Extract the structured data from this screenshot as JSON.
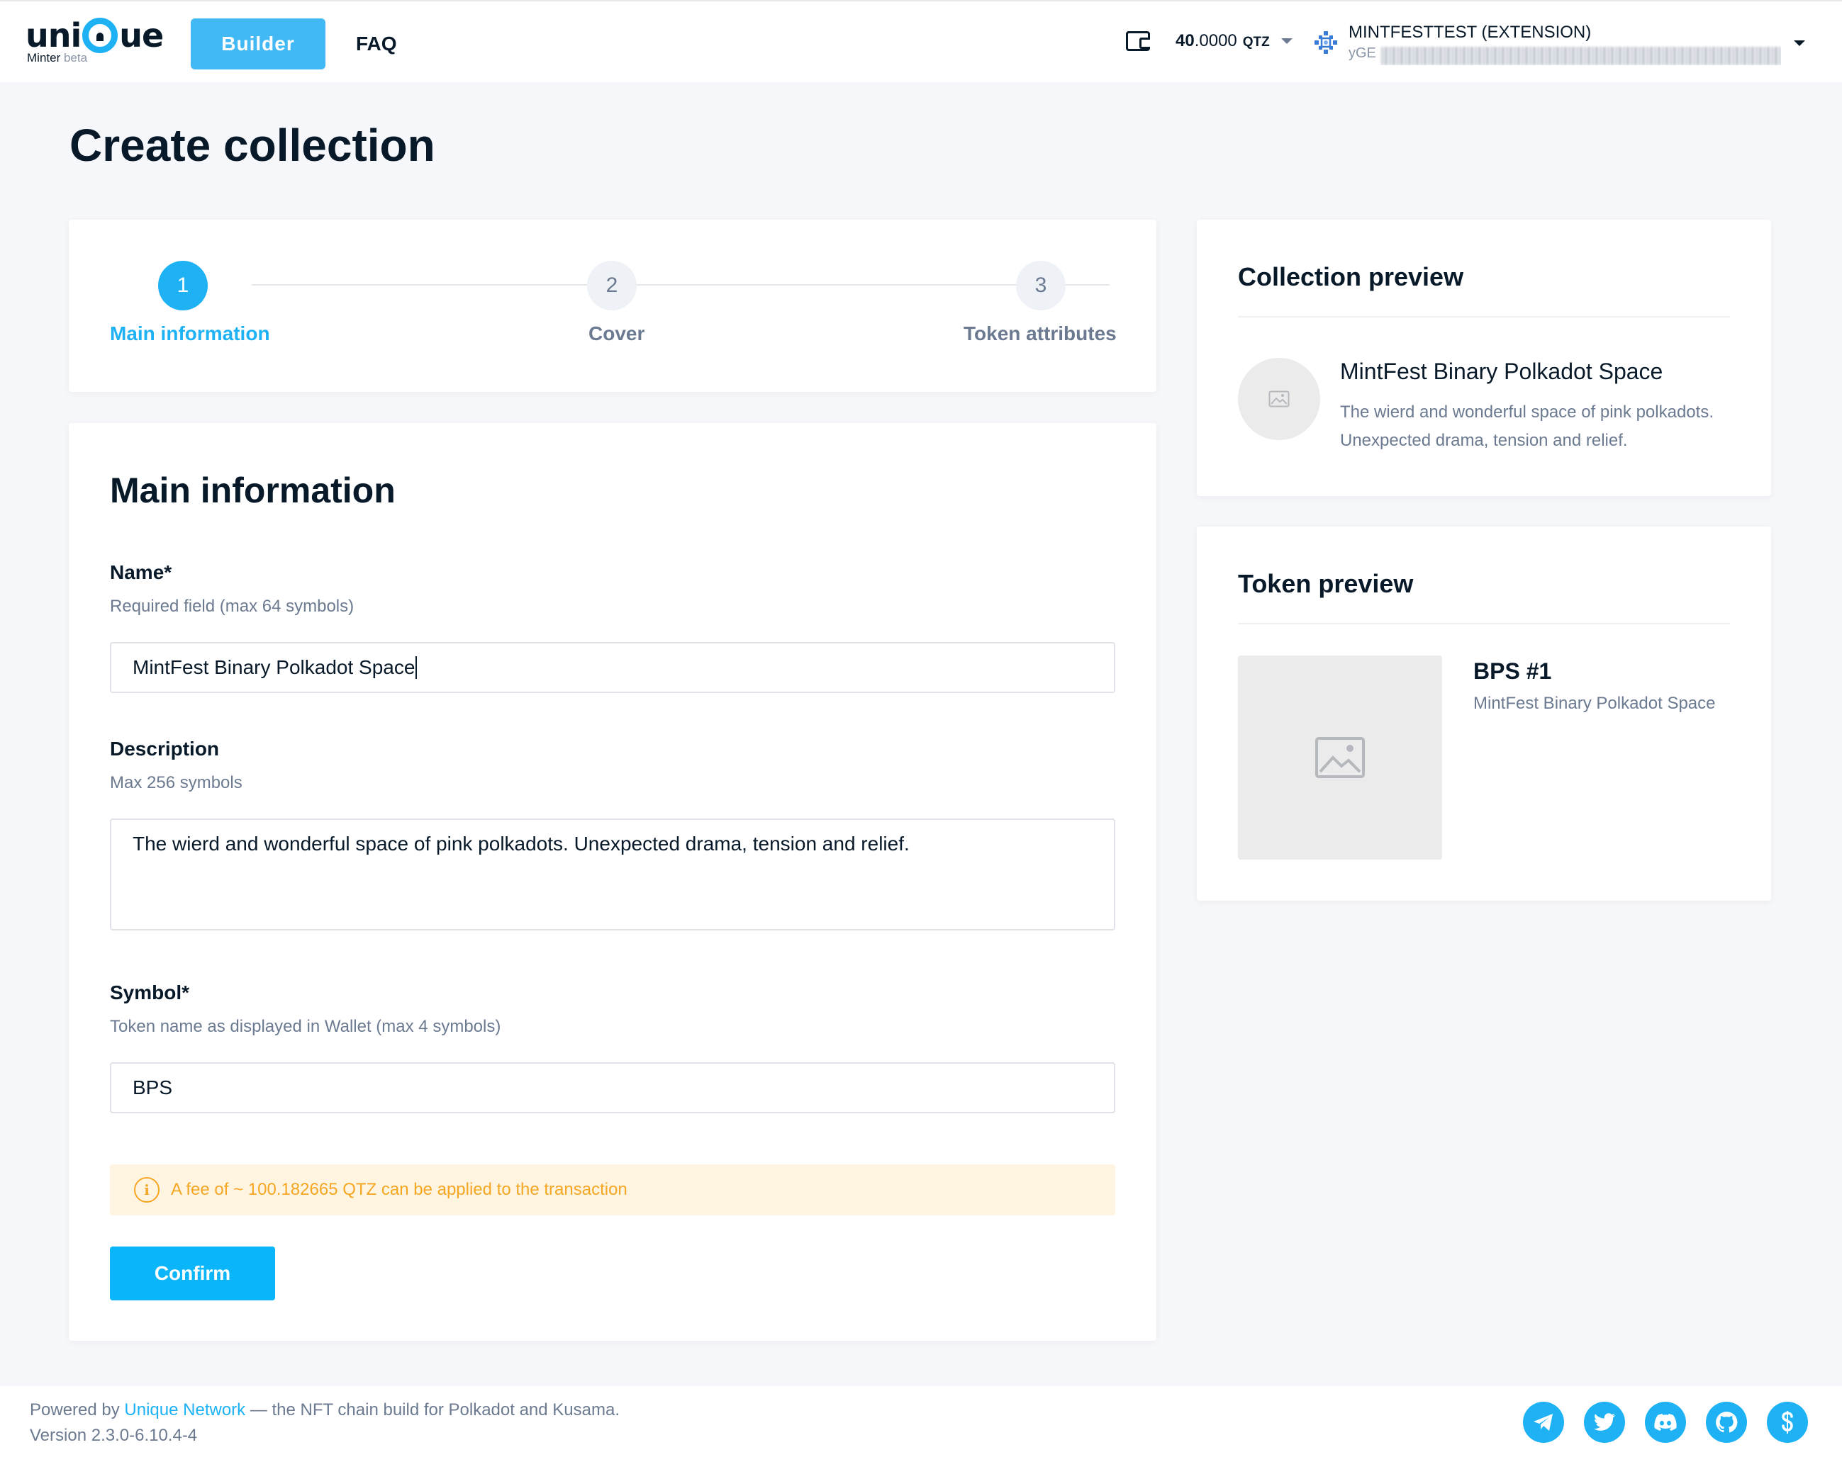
{
  "header": {
    "logo_text_left": "uni",
    "logo_text_right": "ue",
    "logo_sub": "Minter",
    "logo_beta": "beta",
    "nav": {
      "builder": "Builder",
      "faq": "FAQ"
    },
    "balance": {
      "amount_int": "40",
      "amount_dec": ".0000",
      "currency": "QTZ"
    },
    "account": {
      "name": "MINTFESTTEST (EXTENSION)",
      "address_prefix": "yGE"
    }
  },
  "page_title": "Create collection",
  "stepper": {
    "steps": [
      {
        "num": "1",
        "label": "Main information",
        "active": true
      },
      {
        "num": "2",
        "label": "Cover",
        "active": false
      },
      {
        "num": "3",
        "label": "Token attributes",
        "active": false
      }
    ]
  },
  "form": {
    "title": "Main information",
    "name": {
      "label": "Name*",
      "hint": "Required field (max 64 symbols)",
      "value": "MintFest Binary Polkadot Space"
    },
    "description": {
      "label": "Description",
      "hint": "Max 256 symbols",
      "value": "The wierd and wonderful space of pink polkadots. Unexpected drama, tension and relief."
    },
    "symbol": {
      "label": "Symbol*",
      "hint": "Token name as displayed in Wallet (max 4 symbols)",
      "value": "BPS"
    },
    "fee_text": "A fee of ~ 100.182665 QTZ can be applied to the transaction",
    "confirm_label": "Confirm"
  },
  "collection_preview": {
    "title": "Collection preview",
    "name": "MintFest Binary Polkadot Space",
    "description": "The wierd and wonderful space of pink polkadots. Unexpected drama, tension and relief."
  },
  "token_preview": {
    "title": "Token preview",
    "token_name": "BPS #1",
    "collection_name": "MintFest Binary Polkadot Space"
  },
  "footer": {
    "powered_by": "Powered by",
    "link_text": "Unique Network",
    "tagline": " — the NFT chain build for Polkadot and Kusama.",
    "version": "Version 2.3.0-6.10.4-4",
    "socials": [
      "telegram-icon",
      "twitter-icon",
      "discord-icon",
      "github-icon",
      "subsocial-icon"
    ]
  },
  "colors": {
    "accent": "#1eb2f5",
    "builder_bg": "#42b8f5",
    "fee_bg": "#fff4e0",
    "fee_text": "#f5a623"
  }
}
